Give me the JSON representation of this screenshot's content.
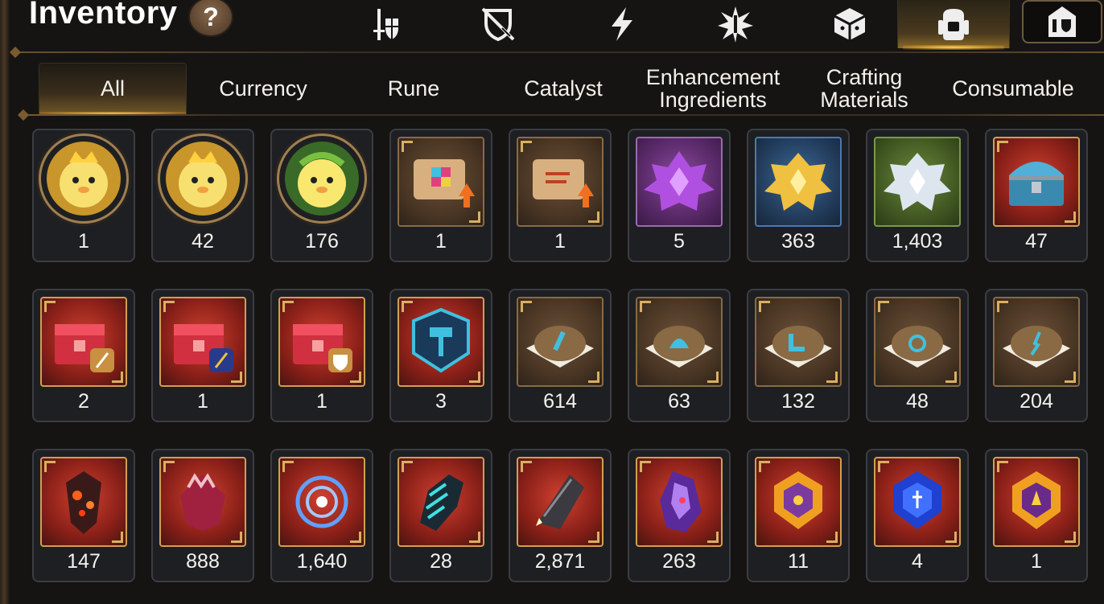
{
  "header": {
    "title": "Inventory",
    "help_glyph": "?",
    "category_tabs": [
      {
        "icon": "sword-shield-icon",
        "active": false
      },
      {
        "icon": "broken-shield-icon",
        "active": false
      },
      {
        "icon": "lightning-icon",
        "active": false
      },
      {
        "icon": "burst-icon",
        "active": false
      },
      {
        "icon": "cube-icon",
        "active": false
      },
      {
        "icon": "backpack-icon",
        "active": true
      },
      {
        "icon": "castle-icon",
        "active": false
      }
    ]
  },
  "filters": [
    {
      "label": "All",
      "active": true
    },
    {
      "label": "Currency",
      "active": false
    },
    {
      "label": "Rune",
      "active": false
    },
    {
      "label": "Catalyst",
      "active": false
    },
    {
      "label": "Enhancement\nIngredients",
      "active": false
    },
    {
      "label": "Crafting\nMaterials",
      "active": false
    },
    {
      "label": "Consumable",
      "active": false
    }
  ],
  "items": [
    {
      "icon": "chick-portrait-gold-icon",
      "frame": "round",
      "qty": "1"
    },
    {
      "icon": "chick-portrait-gold-icon",
      "frame": "round",
      "qty": "42"
    },
    {
      "icon": "chick-portrait-leaf-icon",
      "frame": "round",
      "qty": "176"
    },
    {
      "icon": "rainbow-scroll-icon",
      "frame": "brown",
      "qty": "1"
    },
    {
      "icon": "upgrade-scroll-icon",
      "frame": "brown",
      "qty": "1"
    },
    {
      "icon": "purple-crystal-icon",
      "frame": "purple",
      "qty": "5"
    },
    {
      "icon": "gold-crystal-icon",
      "frame": "blue",
      "qty": "363"
    },
    {
      "icon": "silver-crystal-icon",
      "frame": "green",
      "qty": "1,403"
    },
    {
      "icon": "blue-chest-icon",
      "frame": "gold",
      "qty": "47"
    },
    {
      "icon": "red-chest-fire-icon",
      "frame": "gold",
      "qty": "2"
    },
    {
      "icon": "red-chest-blue-icon",
      "frame": "gold",
      "qty": "1"
    },
    {
      "icon": "red-chest-shield-icon",
      "frame": "gold",
      "qty": "1"
    },
    {
      "icon": "hammer-rune-icon",
      "frame": "gold",
      "qty": "3"
    },
    {
      "icon": "sand-rune-sword-icon",
      "frame": "brown",
      "qty": "614"
    },
    {
      "icon": "sand-rune-helm-icon",
      "frame": "brown",
      "qty": "63"
    },
    {
      "icon": "sand-rune-boot-icon",
      "frame": "brown",
      "qty": "132"
    },
    {
      "icon": "sand-rune-ring-icon",
      "frame": "brown",
      "qty": "48"
    },
    {
      "icon": "sand-rune-amulet-icon",
      "frame": "brown",
      "qty": "204"
    },
    {
      "icon": "lava-crystal-icon",
      "frame": "gold",
      "qty": "147"
    },
    {
      "icon": "crimson-shard-icon",
      "frame": "gold",
      "qty": "888"
    },
    {
      "icon": "blue-vortex-icon",
      "frame": "gold",
      "qty": "1,640"
    },
    {
      "icon": "teal-shard-icon",
      "frame": "gold",
      "qty": "28"
    },
    {
      "icon": "obsidian-shard-icon",
      "frame": "gold",
      "qty": "2,871"
    },
    {
      "icon": "violet-gem-icon",
      "frame": "gold",
      "qty": "263"
    },
    {
      "icon": "amber-gem-icon",
      "frame": "gold",
      "qty": "11"
    },
    {
      "icon": "sapphire-gem-icon",
      "frame": "gold",
      "qty": "4"
    },
    {
      "icon": "topaz-gem-icon",
      "frame": "gold",
      "qty": "1"
    }
  ],
  "colors": {
    "background": "#151413",
    "slot_bg": "#1e1f22",
    "accent_gold": "#d8b060",
    "text": "#f4f2ee"
  }
}
